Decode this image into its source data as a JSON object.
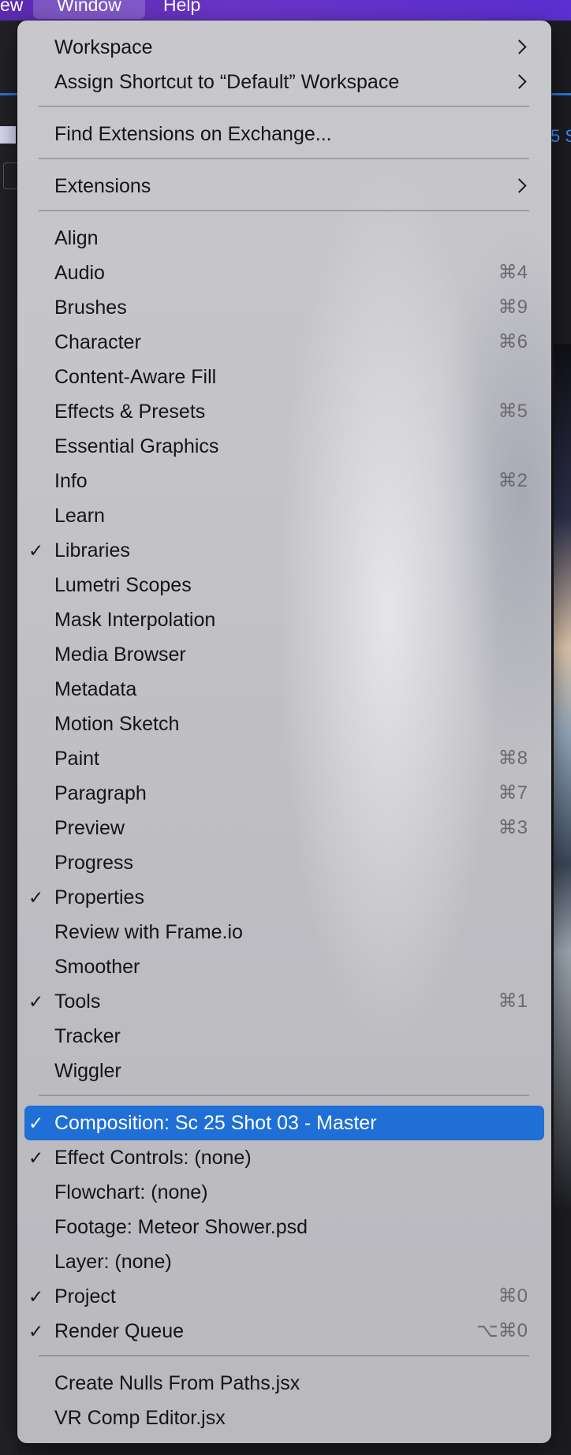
{
  "menubar": {
    "view": "ew",
    "window": "Window",
    "help": "Help"
  },
  "background": {
    "right_tab_text": "5 S"
  },
  "menu": {
    "workspace": "Workspace",
    "assign_shortcut": "Assign Shortcut to “Default” Workspace",
    "find_extensions": "Find Extensions on Exchange...",
    "extensions": "Extensions",
    "align": "Align",
    "audio": "Audio",
    "audio_sc": "⌘4",
    "brushes": "Brushes",
    "brushes_sc": "⌘9",
    "character": "Character",
    "character_sc": "⌘6",
    "content_aware_fill": "Content-Aware Fill",
    "effects_presets": "Effects & Presets",
    "effects_presets_sc": "⌘5",
    "essential_graphics": "Essential Graphics",
    "info": "Info",
    "info_sc": "⌘2",
    "learn": "Learn",
    "libraries": "Libraries",
    "lumetri_scopes": "Lumetri Scopes",
    "mask_interpolation": "Mask Interpolation",
    "media_browser": "Media Browser",
    "metadata": "Metadata",
    "motion_sketch": "Motion Sketch",
    "paint": "Paint",
    "paint_sc": "⌘8",
    "paragraph": "Paragraph",
    "paragraph_sc": "⌘7",
    "preview": "Preview",
    "preview_sc": "⌘3",
    "progress": "Progress",
    "properties": "Properties",
    "review_frameio": "Review with Frame.io",
    "smoother": "Smoother",
    "tools": "Tools",
    "tools_sc": "⌘1",
    "tracker": "Tracker",
    "wiggler": "Wiggler",
    "composition": "Composition: Sc 25 Shot 03 - Master",
    "effect_controls": "Effect Controls: (none)",
    "flowchart": "Flowchart: (none)",
    "footage": "Footage: Meteor Shower.psd",
    "layer": "Layer: (none)",
    "project": "Project",
    "project_sc": "⌘0",
    "render_queue": "Render Queue",
    "render_queue_sc": "⌥⌘0",
    "create_nulls": "Create Nulls From Paths.jsx",
    "vr_comp_editor": "VR Comp Editor.jsx",
    "check_mark": "✓"
  }
}
